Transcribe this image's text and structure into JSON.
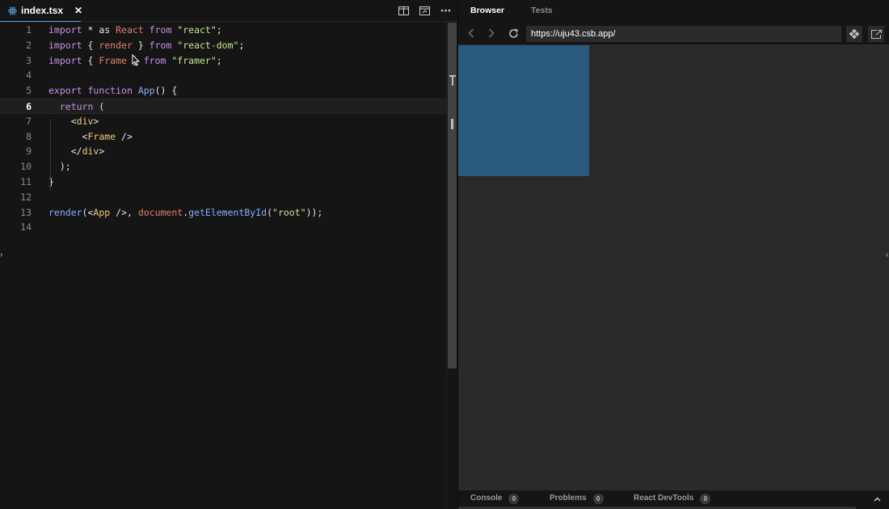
{
  "editor": {
    "tab": {
      "filename": "index.tsx",
      "close": "✕"
    },
    "actions": [
      "split-editor-icon",
      "preview-window-icon",
      "more-icon"
    ],
    "active_line": 6,
    "lines": [
      {
        "n": "1",
        "tokens": [
          [
            "kw",
            "import"
          ],
          [
            "pn",
            " * "
          ],
          [
            "pn",
            "as "
          ],
          [
            "id",
            "React"
          ],
          [
            "pn",
            " "
          ],
          [
            "kw",
            "from"
          ],
          [
            "pn",
            " "
          ],
          [
            "str",
            "\"react\""
          ],
          [
            "pn",
            ";"
          ]
        ]
      },
      {
        "n": "2",
        "tokens": [
          [
            "kw",
            "import"
          ],
          [
            "pn",
            " { "
          ],
          [
            "id",
            "render"
          ],
          [
            "pn",
            " } "
          ],
          [
            "kw",
            "from"
          ],
          [
            "pn",
            " "
          ],
          [
            "str",
            "\"react-dom\""
          ],
          [
            "pn",
            ";"
          ]
        ]
      },
      {
        "n": "3",
        "tokens": [
          [
            "kw",
            "import"
          ],
          [
            "pn",
            " { "
          ],
          [
            "id",
            "Frame"
          ],
          [
            "pn",
            " } "
          ],
          [
            "kw",
            "from"
          ],
          [
            "pn",
            " "
          ],
          [
            "str",
            "\"framer\""
          ],
          [
            "pn",
            ";"
          ]
        ]
      },
      {
        "n": "4",
        "tokens": []
      },
      {
        "n": "5",
        "tokens": [
          [
            "kw",
            "export"
          ],
          [
            "pn",
            " "
          ],
          [
            "kw",
            "function"
          ],
          [
            "pn",
            " "
          ],
          [
            "fn",
            "App"
          ],
          [
            "pn",
            "() {"
          ]
        ]
      },
      {
        "n": "6",
        "tokens": [
          [
            "pn",
            "  "
          ],
          [
            "kw",
            "return"
          ],
          [
            "pn",
            " ("
          ]
        ]
      },
      {
        "n": "7",
        "tokens": [
          [
            "pn",
            "    "
          ],
          [
            "pn",
            "<"
          ],
          [
            "tag",
            "div"
          ],
          [
            "pn",
            ">"
          ]
        ]
      },
      {
        "n": "8",
        "tokens": [
          [
            "pn",
            "      "
          ],
          [
            "pn",
            "<"
          ],
          [
            "tag",
            "Frame"
          ],
          [
            "pn",
            " />"
          ]
        ]
      },
      {
        "n": "9",
        "tokens": [
          [
            "pn",
            "    "
          ],
          [
            "pn",
            "</"
          ],
          [
            "tag",
            "div"
          ],
          [
            "pn",
            ">"
          ]
        ]
      },
      {
        "n": "10",
        "tokens": [
          [
            "pn",
            "  );"
          ]
        ]
      },
      {
        "n": "11",
        "tokens": [
          [
            "pn",
            "}"
          ]
        ]
      },
      {
        "n": "12",
        "tokens": []
      },
      {
        "n": "13",
        "tokens": [
          [
            "fn",
            "render"
          ],
          [
            "pn",
            "(<"
          ],
          [
            "tag",
            "App"
          ],
          [
            "pn",
            " />, "
          ],
          [
            "id",
            "document"
          ],
          [
            "pn",
            "."
          ],
          [
            "fn",
            "getElementById"
          ],
          [
            "pn",
            "("
          ],
          [
            "str",
            "\"root\""
          ],
          [
            "pn",
            "));"
          ]
        ]
      },
      {
        "n": "14",
        "tokens": []
      }
    ]
  },
  "preview": {
    "tabs": {
      "browser": "Browser",
      "tests": "Tests"
    },
    "url": "https://uju43.csb.app/",
    "frame_color": "#2a5a7d",
    "devtools": {
      "console": {
        "label": "Console",
        "count": "0"
      },
      "problems": {
        "label": "Problems",
        "count": "0"
      },
      "react": {
        "label": "React DevTools",
        "count": "0"
      }
    }
  },
  "colors": {
    "editor_bg": "#151515",
    "preview_bg": "#2a2a2a",
    "accent": "#5aa9e6",
    "keyword": "#c792ea",
    "string": "#c3e88d",
    "identifier": "#e57e6b",
    "function": "#82b0ff"
  }
}
